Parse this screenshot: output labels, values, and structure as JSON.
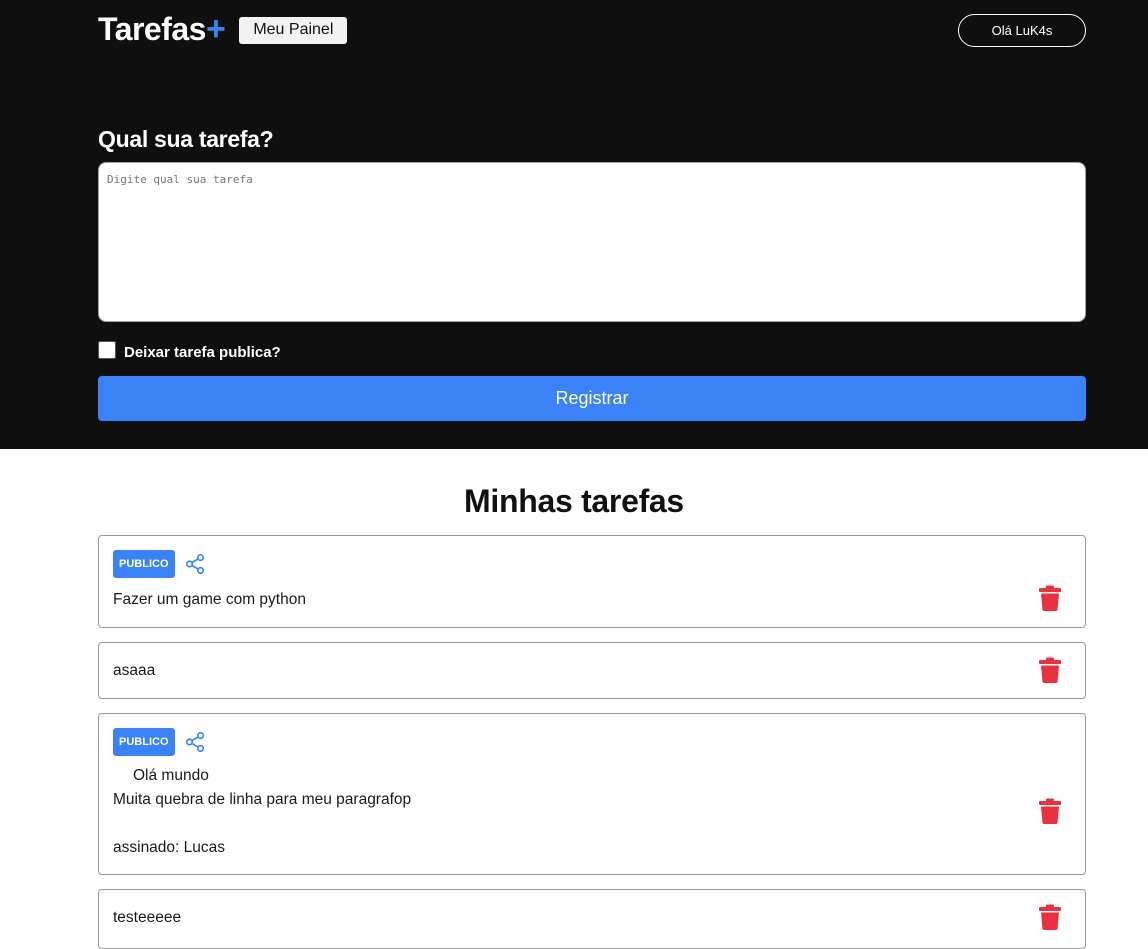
{
  "header": {
    "logo": "Tarefas",
    "logo_plus": "+",
    "panel_button": "Meu Painel",
    "user_button": "Olá LuK4s"
  },
  "form": {
    "title": "Qual sua tarefa?",
    "placeholder": "Digite qual sua tarefa",
    "public_checkbox_label": "Deixar tarefa publica?",
    "public_checked": false,
    "submit_label": "Registrar"
  },
  "tasks_section": {
    "title": "Minhas tarefas",
    "tasks": [
      {
        "public": true,
        "badge": "PUBLICO",
        "lines": [
          "Fazer um game com python"
        ]
      },
      {
        "public": false,
        "lines": [
          "asaaa"
        ]
      },
      {
        "public": true,
        "badge": "PUBLICO",
        "lines": [
          "Olá mundo",
          "Muita quebra de linha para meu paragrafop",
          "",
          "assinado: Lucas"
        ]
      },
      {
        "public": false,
        "lines": [
          "testeeeee"
        ]
      }
    ]
  },
  "colors": {
    "accent": "#3b82f6",
    "dark_bg": "#0f0f0f",
    "delete": "#ea3140"
  },
  "icons": {
    "share": "share-icon",
    "delete": "trash-icon"
  }
}
